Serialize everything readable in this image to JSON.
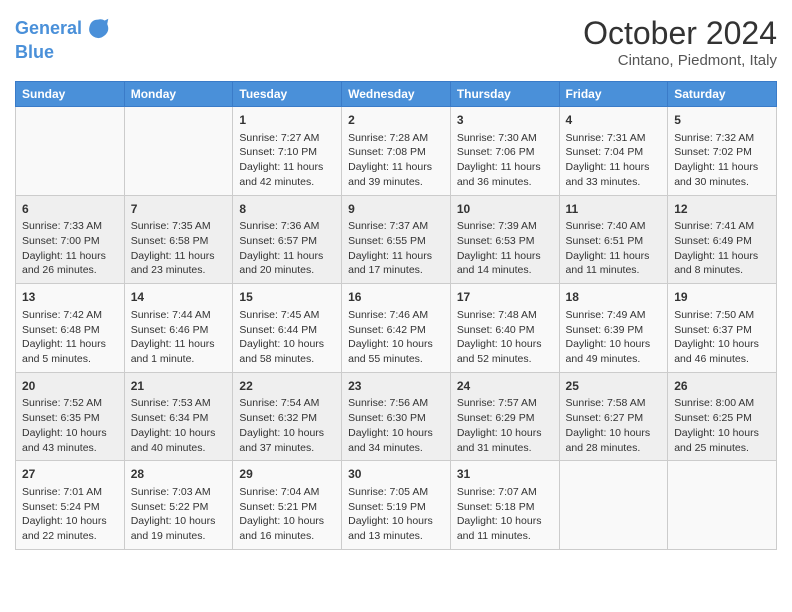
{
  "header": {
    "logo_line1": "General",
    "logo_line2": "Blue",
    "month": "October 2024",
    "location": "Cintano, Piedmont, Italy"
  },
  "weekdays": [
    "Sunday",
    "Monday",
    "Tuesday",
    "Wednesday",
    "Thursday",
    "Friday",
    "Saturday"
  ],
  "rows": [
    [
      {
        "day": "",
        "sunrise": "",
        "sunset": "",
        "daylight": ""
      },
      {
        "day": "",
        "sunrise": "",
        "sunset": "",
        "daylight": ""
      },
      {
        "day": "1",
        "sunrise": "Sunrise: 7:27 AM",
        "sunset": "Sunset: 7:10 PM",
        "daylight": "Daylight: 11 hours and 42 minutes."
      },
      {
        "day": "2",
        "sunrise": "Sunrise: 7:28 AM",
        "sunset": "Sunset: 7:08 PM",
        "daylight": "Daylight: 11 hours and 39 minutes."
      },
      {
        "day": "3",
        "sunrise": "Sunrise: 7:30 AM",
        "sunset": "Sunset: 7:06 PM",
        "daylight": "Daylight: 11 hours and 36 minutes."
      },
      {
        "day": "4",
        "sunrise": "Sunrise: 7:31 AM",
        "sunset": "Sunset: 7:04 PM",
        "daylight": "Daylight: 11 hours and 33 minutes."
      },
      {
        "day": "5",
        "sunrise": "Sunrise: 7:32 AM",
        "sunset": "Sunset: 7:02 PM",
        "daylight": "Daylight: 11 hours and 30 minutes."
      }
    ],
    [
      {
        "day": "6",
        "sunrise": "Sunrise: 7:33 AM",
        "sunset": "Sunset: 7:00 PM",
        "daylight": "Daylight: 11 hours and 26 minutes."
      },
      {
        "day": "7",
        "sunrise": "Sunrise: 7:35 AM",
        "sunset": "Sunset: 6:58 PM",
        "daylight": "Daylight: 11 hours and 23 minutes."
      },
      {
        "day": "8",
        "sunrise": "Sunrise: 7:36 AM",
        "sunset": "Sunset: 6:57 PM",
        "daylight": "Daylight: 11 hours and 20 minutes."
      },
      {
        "day": "9",
        "sunrise": "Sunrise: 7:37 AM",
        "sunset": "Sunset: 6:55 PM",
        "daylight": "Daylight: 11 hours and 17 minutes."
      },
      {
        "day": "10",
        "sunrise": "Sunrise: 7:39 AM",
        "sunset": "Sunset: 6:53 PM",
        "daylight": "Daylight: 11 hours and 14 minutes."
      },
      {
        "day": "11",
        "sunrise": "Sunrise: 7:40 AM",
        "sunset": "Sunset: 6:51 PM",
        "daylight": "Daylight: 11 hours and 11 minutes."
      },
      {
        "day": "12",
        "sunrise": "Sunrise: 7:41 AM",
        "sunset": "Sunset: 6:49 PM",
        "daylight": "Daylight: 11 hours and 8 minutes."
      }
    ],
    [
      {
        "day": "13",
        "sunrise": "Sunrise: 7:42 AM",
        "sunset": "Sunset: 6:48 PM",
        "daylight": "Daylight: 11 hours and 5 minutes."
      },
      {
        "day": "14",
        "sunrise": "Sunrise: 7:44 AM",
        "sunset": "Sunset: 6:46 PM",
        "daylight": "Daylight: 11 hours and 1 minute."
      },
      {
        "day": "15",
        "sunrise": "Sunrise: 7:45 AM",
        "sunset": "Sunset: 6:44 PM",
        "daylight": "Daylight: 10 hours and 58 minutes."
      },
      {
        "day": "16",
        "sunrise": "Sunrise: 7:46 AM",
        "sunset": "Sunset: 6:42 PM",
        "daylight": "Daylight: 10 hours and 55 minutes."
      },
      {
        "day": "17",
        "sunrise": "Sunrise: 7:48 AM",
        "sunset": "Sunset: 6:40 PM",
        "daylight": "Daylight: 10 hours and 52 minutes."
      },
      {
        "day": "18",
        "sunrise": "Sunrise: 7:49 AM",
        "sunset": "Sunset: 6:39 PM",
        "daylight": "Daylight: 10 hours and 49 minutes."
      },
      {
        "day": "19",
        "sunrise": "Sunrise: 7:50 AM",
        "sunset": "Sunset: 6:37 PM",
        "daylight": "Daylight: 10 hours and 46 minutes."
      }
    ],
    [
      {
        "day": "20",
        "sunrise": "Sunrise: 7:52 AM",
        "sunset": "Sunset: 6:35 PM",
        "daylight": "Daylight: 10 hours and 43 minutes."
      },
      {
        "day": "21",
        "sunrise": "Sunrise: 7:53 AM",
        "sunset": "Sunset: 6:34 PM",
        "daylight": "Daylight: 10 hours and 40 minutes."
      },
      {
        "day": "22",
        "sunrise": "Sunrise: 7:54 AM",
        "sunset": "Sunset: 6:32 PM",
        "daylight": "Daylight: 10 hours and 37 minutes."
      },
      {
        "day": "23",
        "sunrise": "Sunrise: 7:56 AM",
        "sunset": "Sunset: 6:30 PM",
        "daylight": "Daylight: 10 hours and 34 minutes."
      },
      {
        "day": "24",
        "sunrise": "Sunrise: 7:57 AM",
        "sunset": "Sunset: 6:29 PM",
        "daylight": "Daylight: 10 hours and 31 minutes."
      },
      {
        "day": "25",
        "sunrise": "Sunrise: 7:58 AM",
        "sunset": "Sunset: 6:27 PM",
        "daylight": "Daylight: 10 hours and 28 minutes."
      },
      {
        "day": "26",
        "sunrise": "Sunrise: 8:00 AM",
        "sunset": "Sunset: 6:25 PM",
        "daylight": "Daylight: 10 hours and 25 minutes."
      }
    ],
    [
      {
        "day": "27",
        "sunrise": "Sunrise: 7:01 AM",
        "sunset": "Sunset: 5:24 PM",
        "daylight": "Daylight: 10 hours and 22 minutes."
      },
      {
        "day": "28",
        "sunrise": "Sunrise: 7:03 AM",
        "sunset": "Sunset: 5:22 PM",
        "daylight": "Daylight: 10 hours and 19 minutes."
      },
      {
        "day": "29",
        "sunrise": "Sunrise: 7:04 AM",
        "sunset": "Sunset: 5:21 PM",
        "daylight": "Daylight: 10 hours and 16 minutes."
      },
      {
        "day": "30",
        "sunrise": "Sunrise: 7:05 AM",
        "sunset": "Sunset: 5:19 PM",
        "daylight": "Daylight: 10 hours and 13 minutes."
      },
      {
        "day": "31",
        "sunrise": "Sunrise: 7:07 AM",
        "sunset": "Sunset: 5:18 PM",
        "daylight": "Daylight: 10 hours and 11 minutes."
      },
      {
        "day": "",
        "sunrise": "",
        "sunset": "",
        "daylight": ""
      },
      {
        "day": "",
        "sunrise": "",
        "sunset": "",
        "daylight": ""
      }
    ]
  ]
}
